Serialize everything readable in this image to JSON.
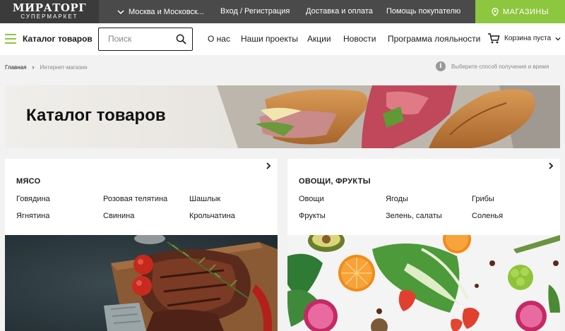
{
  "header": {
    "logo_main": "МИРАТОРГ",
    "logo_sub": "СУПЕРМАРКЕТ",
    "region": "Москва и Московск...",
    "login": "Вход / Регистрация",
    "delivery": "Доставка и оплата",
    "help": "Помощь покупателю",
    "stores": "МАГАЗИНЫ"
  },
  "nav": {
    "catalog": "Каталог товаров",
    "search_placeholder": "Поиск",
    "items": [
      "О нас",
      "Наши проекты",
      "Акции",
      "Новости",
      "Программа лояльности"
    ],
    "cart": "Корзина пуста"
  },
  "breadcrumb": {
    "home": "Главная",
    "separator": "›",
    "current": "Интернет-магазин",
    "delivery_choice": "Выберите способ получения и время"
  },
  "banner": {
    "title": "Каталог товаров"
  },
  "categories": [
    {
      "title": "МЯСО",
      "items": [
        "Говядина",
        "Розовая телятина",
        "Шашлык",
        "Ягнятина",
        "Свинина",
        "Крольчатина"
      ]
    },
    {
      "title": "ОВОЩИ, ФРУКТЫ",
      "items": [
        "Овощи",
        "Ягоды",
        "Грибы",
        "Фрукты",
        "Зелень, салаты",
        "Соленья"
      ]
    }
  ],
  "colors": {
    "accent": "#8dc63f",
    "topbar": "#4a4a4a",
    "logo_bg": "#3b3b3b"
  },
  "icons": {
    "region_chevron": "chevron-down-icon",
    "stores": "location-pin-icon",
    "search": "search-icon",
    "cart": "cart-icon",
    "info": "info-icon",
    "card_arrow": "chevron-right-icon"
  }
}
